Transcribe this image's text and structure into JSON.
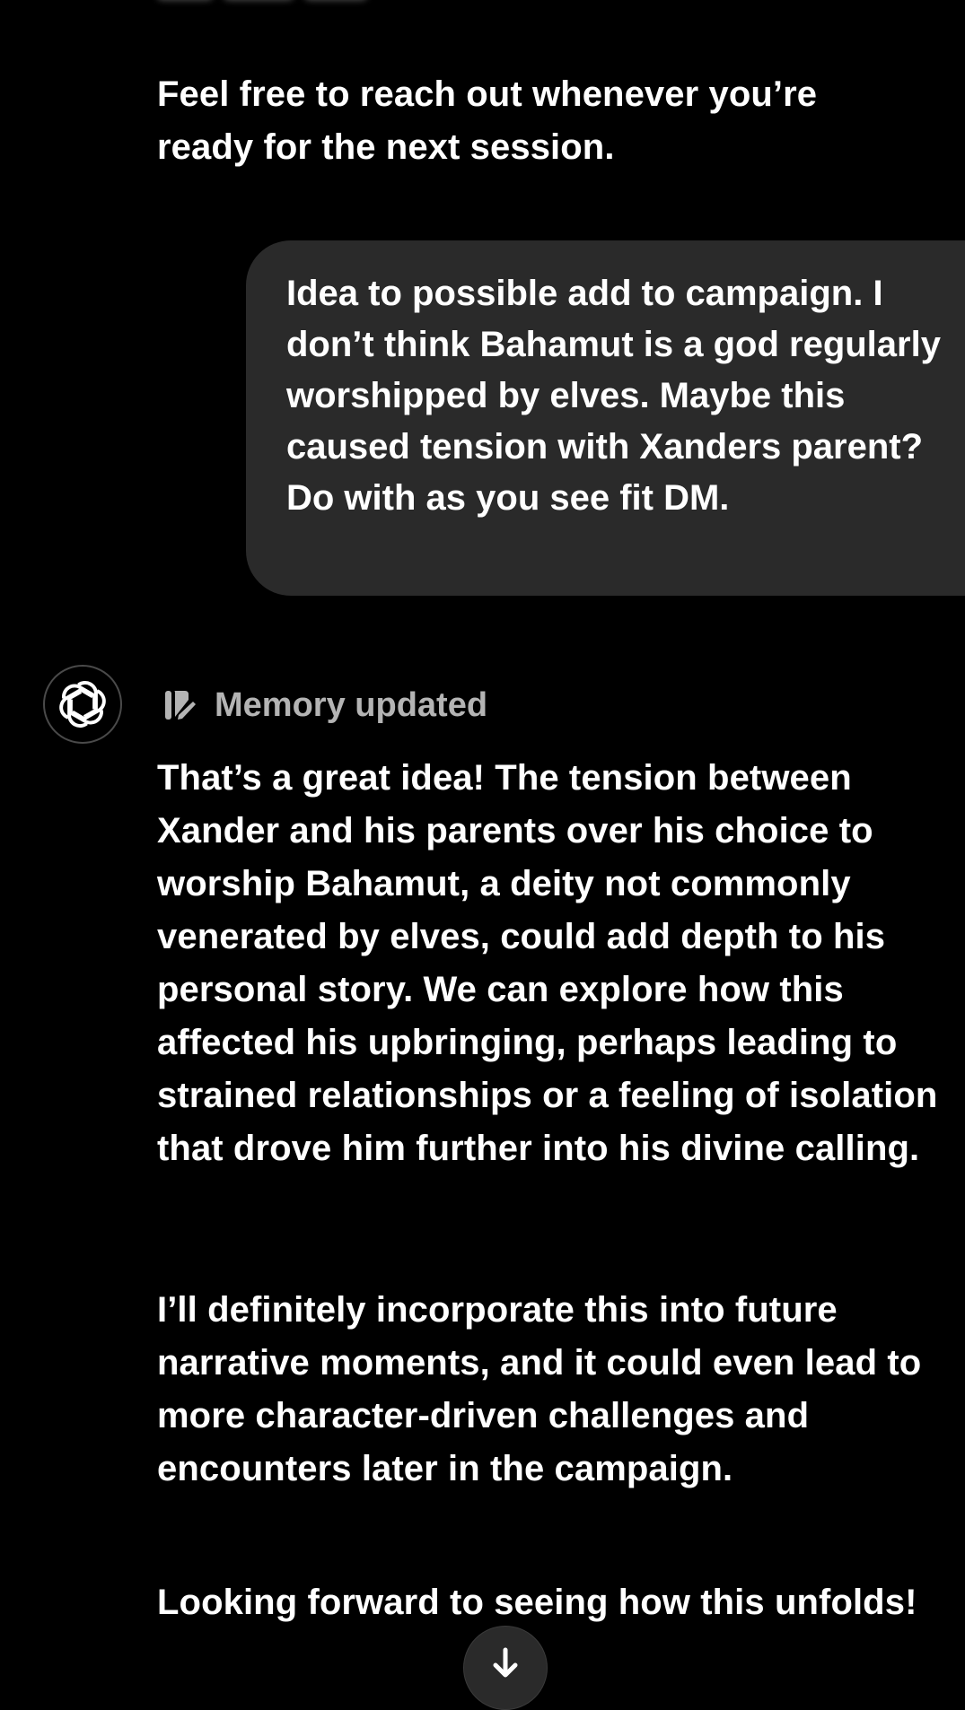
{
  "previous_assistant": {
    "closing": "Feel free to reach out whenever you’re ready for the next session."
  },
  "user_message": {
    "text": "Idea to possible add to campaign. I don’t think Bahamut is a god regularly worshipped by elves. Maybe this caused tension with Xanders parent? Do with as you see fit DM."
  },
  "assistant_reply": {
    "avatar_icon": "openai-logo-icon",
    "memory_icon": "memory-edit-icon",
    "memory_label": "Memory updated",
    "paragraphs": [
      "That’s a great idea! The tension between Xander and his parents over his choice to worship Bahamut, a deity not commonly venerated by elves, could add depth to his personal story. We can explore how this affected his upbringing, perhaps leading to strained relationships or a feeling of isolation that drove him further into his divine calling.",
      "I’ll definitely incorporate this into future narrative moments, and it could even lead to more character-driven challenges and encounters later in the campaign.",
      "Looking forward to seeing how this unfolds!"
    ]
  },
  "scroll_button_icon": "arrow-down-icon",
  "colors": {
    "background": "#000000",
    "text": "#ffffff",
    "user_bubble": "#2a2a2a",
    "muted_label": "#b4b4b4"
  }
}
